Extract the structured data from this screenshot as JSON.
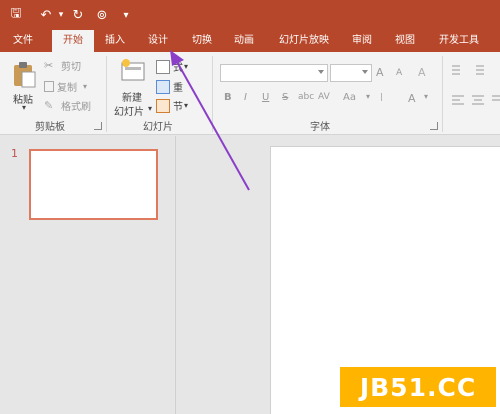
{
  "qat": {
    "save": "🖫",
    "undo": "↶",
    "redo": "↻",
    "present": "⊚",
    "customize": "▾"
  },
  "tabs": [
    "文件",
    "开始",
    "插入",
    "设计",
    "切换",
    "动画",
    "幻灯片放映",
    "审阅",
    "视图",
    "开发工具"
  ],
  "ribbon": {
    "clipboard": {
      "paste": "粘贴",
      "cut": "剪切",
      "copy": "复制",
      "format_painter": "格式刷",
      "label": "剪贴板"
    },
    "slides": {
      "new_slide_line1": "新建",
      "new_slide_line2": "幻灯片",
      "layout": "式",
      "reset": "重",
      "section": "节",
      "label": "幻灯片"
    },
    "font": {
      "grow": "A",
      "shrink": "A",
      "clear": "A",
      "bold": "B",
      "italic": "I",
      "underline": "U",
      "strike": "S",
      "shadow": "abc",
      "spacing": "AV",
      "case": "Aa",
      "color": "A",
      "label": "字体"
    }
  },
  "thumbnails": {
    "slide_number": "1"
  },
  "watermark": "JB51.CC",
  "colors": {
    "accent": "#b7472a",
    "arrow": "#8b3fc9",
    "watermark": "#ffb400"
  }
}
